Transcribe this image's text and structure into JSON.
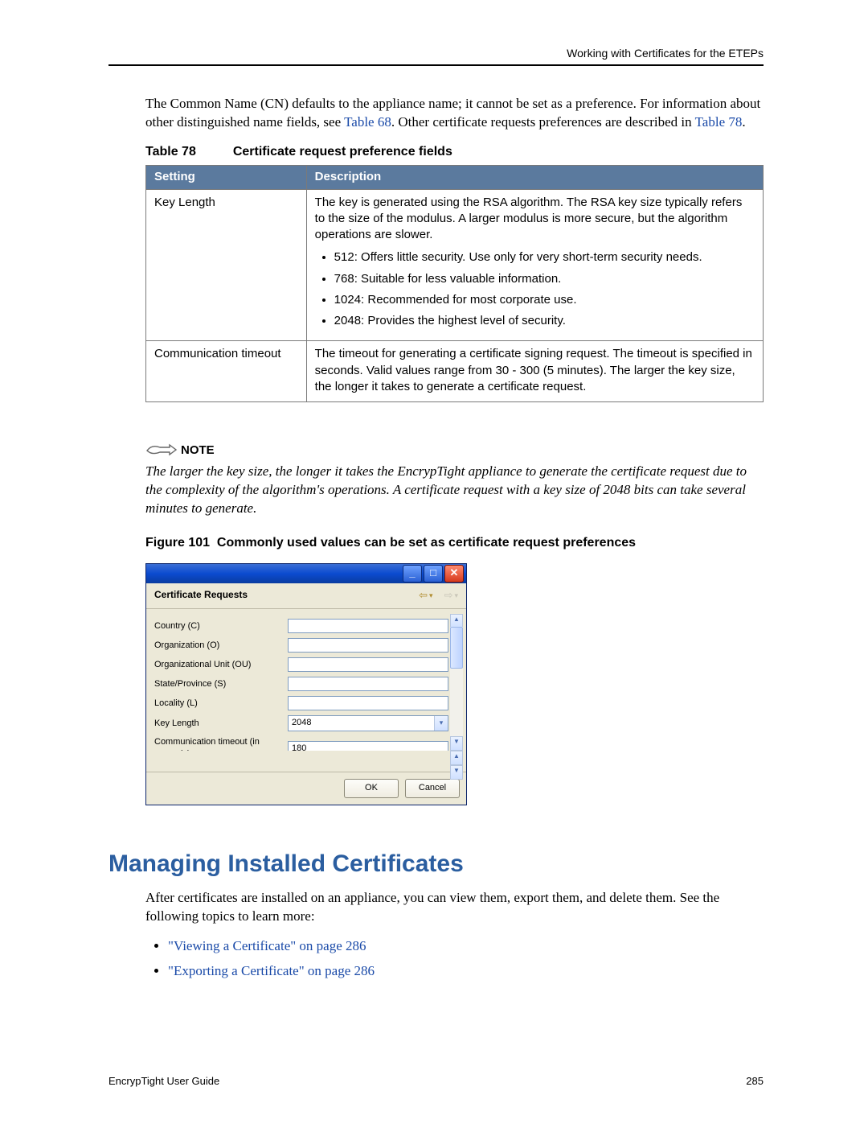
{
  "header": {
    "right": "Working with Certificates for the ETEPs"
  },
  "intro": {
    "p1a": "The Common Name (CN) defaults to the appliance name; it cannot be set as a preference. For information about other distinguished name fields, see ",
    "link1": "Table 68",
    "p1b": ". Other certificate requests preferences are described in ",
    "link2": "Table 78",
    "p1c": "."
  },
  "table78": {
    "label": "Table 78",
    "title": "Certificate request preference fields",
    "cols": {
      "setting": "Setting",
      "description": "Description"
    },
    "rows": [
      {
        "setting": "Key Length",
        "intro": "The key is generated using the RSA algorithm. The RSA key size typically refers to the size of the modulus. A larger modulus is more secure, but the algorithm operations are slower.",
        "bullets": [
          "512: Offers little security. Use only for very short-term security needs.",
          "768: Suitable for less valuable information.",
          "1024: Recommended for most corporate use.",
          "2048: Provides the highest level of security."
        ]
      },
      {
        "setting": "Communication timeout",
        "intro": "The timeout for generating a certificate signing request. The timeout is specified in seconds. Valid values range from 30 - 300 (5 minutes). The larger the key size, the longer it takes to generate a certificate request."
      }
    ]
  },
  "note": {
    "head": "NOTE",
    "text": "The larger the key size, the longer it takes the EncrypTight appliance to generate the certificate request due to the complexity of the algorithm's operations. A certificate request with a key size of 2048 bits can take several minutes to generate."
  },
  "figure101": {
    "label": "Figure 101",
    "title": "Commonly used values can be set as certificate request preferences"
  },
  "dialog": {
    "title": "Certificate Requests",
    "fields": [
      {
        "label": "Country (C)",
        "type": "text",
        "value": ""
      },
      {
        "label": "Organization (O)",
        "type": "text",
        "value": ""
      },
      {
        "label": "Organizational Unit (OU)",
        "type": "text",
        "value": ""
      },
      {
        "label": "State/Province (S)",
        "type": "text",
        "value": ""
      },
      {
        "label": "Locality (L)",
        "type": "text",
        "value": ""
      },
      {
        "label": "Key Length",
        "type": "select",
        "value": "2048"
      },
      {
        "label": "Communication timeout (in seconds)",
        "type": "text",
        "value": "180"
      }
    ],
    "buttons": {
      "ok": "OK",
      "cancel": "Cancel"
    }
  },
  "h1": "Managing Installed Certificates",
  "afterh1": "After certificates are installed on an appliance, you can view them, export them, and delete them. See the following topics to learn more:",
  "topics": [
    "\"Viewing a Certificate\" on page 286",
    "\"Exporting a Certificate\" on page 286"
  ],
  "footer": {
    "left": "EncrypTight User Guide",
    "right": "285"
  }
}
